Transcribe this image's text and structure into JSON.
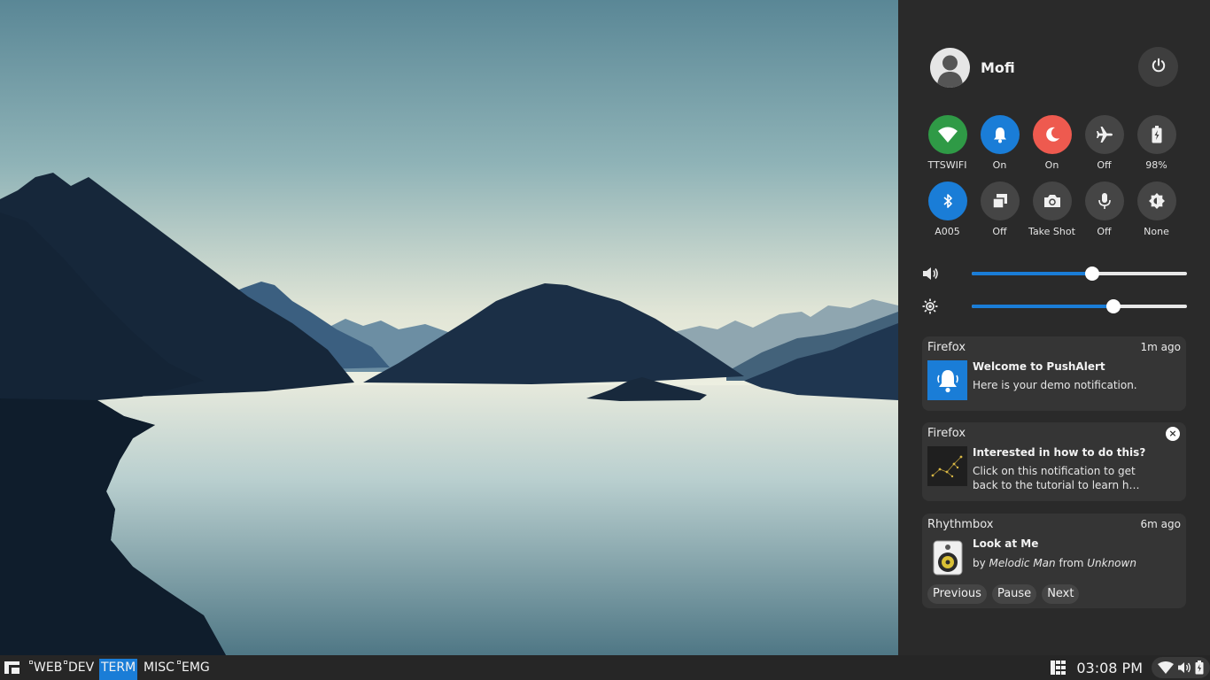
{
  "panel": {
    "user": {
      "name": "Mofi"
    },
    "toggles_row1": [
      {
        "label": "TTSWIFI",
        "icon": "wifi-icon",
        "color": "#2f9a46"
      },
      {
        "label": "On",
        "icon": "bell-icon",
        "color": "#1a7dd7"
      },
      {
        "label": "On",
        "icon": "moon-icon",
        "color": "#ee5a4f"
      },
      {
        "label": "Off",
        "icon": "airplane-icon",
        "color": "#454545"
      },
      {
        "label": "98%",
        "icon": "battery-icon",
        "color": "#454545"
      }
    ],
    "toggles_row2": [
      {
        "label": "A005",
        "icon": "bluetooth-icon",
        "color": "#1a7dd7"
      },
      {
        "label": "Off",
        "icon": "window-stack-icon",
        "color": "#454545"
      },
      {
        "label": "Take Shot",
        "icon": "camera-icon",
        "color": "#454545"
      },
      {
        "label": "Off",
        "icon": "microphone-icon",
        "color": "#454545"
      },
      {
        "label": "None",
        "icon": "brightness-auto-icon",
        "color": "#454545"
      }
    ],
    "volume_level": 0.56,
    "brightness_level": 0.66,
    "notifications": [
      {
        "app": "Firefox",
        "time": "1m ago",
        "title": "Welcome to PushAlert",
        "body": "Here is your demo notification."
      },
      {
        "app": "Firefox",
        "title": "Interested in how to do this?",
        "body": "Click on this notification to get back to the tutorial to learn h…",
        "close": "×"
      },
      {
        "app": "Rhythmbox",
        "time": "6m ago",
        "title": "Look at Me",
        "by": "by",
        "artist": "Melodic Man",
        "from": "from",
        "album": "Unknown",
        "buttons": [
          "Previous",
          "Pause",
          "Next"
        ]
      }
    ]
  },
  "taskbar": {
    "workspaces": [
      "WEB",
      "DEV",
      "TERM",
      "MISC",
      "EMG"
    ],
    "active_workspace": "TERM",
    "clock": "03:08 PM"
  },
  "colors": {
    "accent": "#1a7dd7",
    "panel_bg": "#2a2a2a",
    "taskbar_bg": "#262626"
  }
}
